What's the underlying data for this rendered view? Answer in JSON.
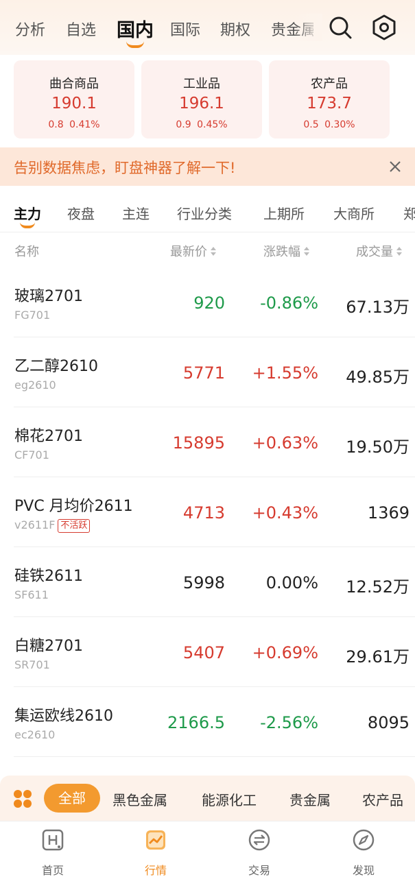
{
  "top_tabs": [
    {
      "label": "分析"
    },
    {
      "label": "自选"
    },
    {
      "label": "国内",
      "active": true
    },
    {
      "label": "国际"
    },
    {
      "label": "期权"
    },
    {
      "label": "贵金属"
    }
  ],
  "top_icons": {
    "search": "search-icon",
    "settings": "settings-icon"
  },
  "index_cards": [
    {
      "name": "曲合商品",
      "value": "190.1",
      "change": "0.8",
      "pct": "0.41%"
    },
    {
      "name": "工业品",
      "value": "196.1",
      "change": "0.9",
      "pct": "0.45%"
    },
    {
      "name": "农产品",
      "value": "173.7",
      "change": "0.5",
      "pct": "0.30%"
    }
  ],
  "banner": {
    "text": "告别数据焦虑，盯盘神器了解一下!",
    "close_icon": "close-icon"
  },
  "category_tabs": [
    {
      "label": "主力",
      "active": true
    },
    {
      "label": "夜盘"
    },
    {
      "label": "主连"
    },
    {
      "label": "行业分类"
    },
    {
      "label": "上期所"
    },
    {
      "label": "大商所"
    },
    {
      "label": "郑"
    }
  ],
  "table": {
    "headers": {
      "name": "名称",
      "price": "最新价",
      "pct": "涨跌幅",
      "volume": "成交量"
    },
    "rows": [
      {
        "name": "玻璃2701",
        "code": "FG701",
        "badge": "",
        "price": "920",
        "pct": "-0.86%",
        "volume": "67.13万",
        "dir": "down"
      },
      {
        "name": "乙二醇2610",
        "code": "eg2610",
        "badge": "",
        "price": "5771",
        "pct": "+1.55%",
        "volume": "49.85万",
        "dir": "up"
      },
      {
        "name": "棉花2701",
        "code": "CF701",
        "badge": "",
        "price": "15895",
        "pct": "+0.63%",
        "volume": "19.50万",
        "dir": "up"
      },
      {
        "name": "PVC 月均价2611",
        "code": "v2611F",
        "badge": "不活跃",
        "price": "4713",
        "pct": "+0.43%",
        "volume": "1369",
        "dir": "up"
      },
      {
        "name": "硅铁2611",
        "code": "SF611",
        "badge": "",
        "price": "5998",
        "pct": "0.00%",
        "volume": "12.52万",
        "dir": "flat"
      },
      {
        "name": "白糖2701",
        "code": "SR701",
        "badge": "",
        "price": "5407",
        "pct": "+0.69%",
        "volume": "29.61万",
        "dir": "up"
      },
      {
        "name": "集运欧线2610",
        "code": "ec2610",
        "badge": "",
        "price": "2166.5",
        "pct": "-2.56%",
        "volume": "8095",
        "dir": "down"
      }
    ]
  },
  "bottom_categories": {
    "active": "全部",
    "options": [
      "黑色金属",
      "能源化工",
      "贵金属",
      "农产品"
    ]
  },
  "bottom_nav": [
    {
      "label": "首页",
      "icon": "home-icon"
    },
    {
      "label": "行情",
      "icon": "market-chart-icon",
      "active": true
    },
    {
      "label": "交易",
      "icon": "trade-exchange-icon"
    },
    {
      "label": "发现",
      "icon": "discover-compass-icon"
    }
  ],
  "colors": {
    "up": "#d63b2f",
    "down": "#1e9a4a",
    "accent": "#f08a1d"
  }
}
